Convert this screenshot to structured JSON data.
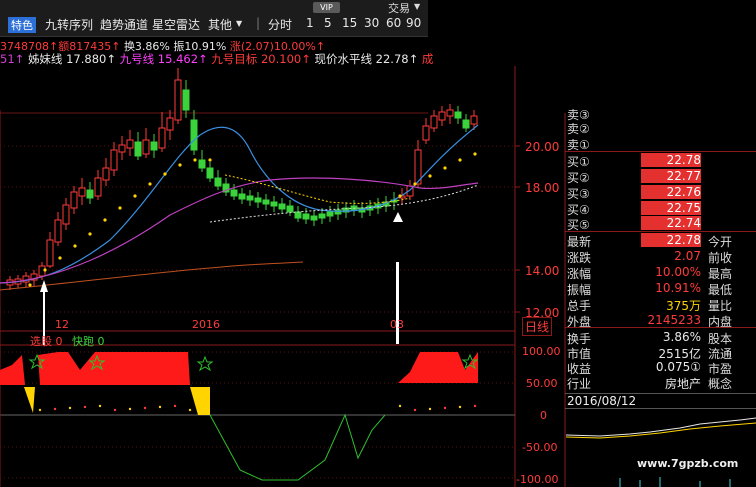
{
  "toolbar": {
    "special_label": "特色",
    "items": [
      "九转序列",
      "趋势通道",
      "星空雷达",
      "其他"
    ],
    "dropdown_caret": "▼",
    "divider": "|",
    "periods": [
      "分时",
      "1",
      "5",
      "15",
      "30",
      "60",
      "90"
    ],
    "vip_label": "VIP",
    "top_right_label": "交易"
  },
  "info_line1": {
    "volume_text": "3748708↑",
    "amount_text": "额817435↑",
    "turnover_text": "换3.86%",
    "amplitude_text": "振10.91%",
    "change_text": "涨(2.07)10.00%↑"
  },
  "info_line2": {
    "prefix": "51↑",
    "sister_line": "姊妹线 17.880↑",
    "nine_line": "九号线 15.462↑",
    "nine_target": "九号目标 20.100↑",
    "price_level": "现价水平线 22.78↑",
    "suffix": "成"
  },
  "price_axis": {
    "labels": [
      "20.00",
      "18.00",
      "14.00",
      "12.00"
    ]
  },
  "date_axis": {
    "labels": [
      "12",
      "2016",
      "03"
    ],
    "period_label": "日线"
  },
  "indicator": {
    "legend_1": "选股",
    "legend_1_val": "0",
    "legend_2": "快跑",
    "legend_2_val": "0",
    "axis_labels": [
      "100.00",
      "50.00",
      "0",
      "-50.00",
      "-100.00"
    ]
  },
  "quote_panel": {
    "sells": [
      {
        "label": "卖③"
      },
      {
        "label": "卖②"
      },
      {
        "label": "卖①"
      }
    ],
    "buys": [
      {
        "label": "买①",
        "price": "22.78"
      },
      {
        "label": "买②",
        "price": "22.77"
      },
      {
        "label": "买③",
        "price": "22.76"
      },
      {
        "label": "买④",
        "price": "22.75"
      },
      {
        "label": "买⑤",
        "price": "22.74"
      }
    ],
    "stats": [
      {
        "label": "最新",
        "value": "22.78",
        "rlabel": "今开"
      },
      {
        "label": "涨跌",
        "value": "2.07",
        "rlabel": "前收"
      },
      {
        "label": "涨幅",
        "value": "10.00%",
        "rlabel": "最高"
      },
      {
        "label": "振幅",
        "value": "10.91%",
        "rlabel": "最低"
      },
      {
        "label": "总手",
        "value": "375万",
        "rlabel": "量比"
      },
      {
        "label": "外盘",
        "value": "2145233",
        "rlabel": "内盘"
      },
      {
        "label": "换手",
        "value": "3.86%",
        "rlabel": "股本"
      },
      {
        "label": "市值",
        "value": "2515亿",
        "rlabel": "流通"
      },
      {
        "label": "收益",
        "value": "0.075①",
        "rlabel": "市盈"
      },
      {
        "label": "行业",
        "value": "房地产",
        "rlabel": "概念"
      }
    ]
  },
  "mini_chart": {
    "date": "2016/08/12"
  },
  "watermark": "www.7gpzb.com",
  "colors": {
    "up": "#ff3b3b",
    "down": "#3bd33b",
    "ma_blue": "#3a8fe0",
    "ma_purple": "#c040c0",
    "accent": "#2c6fd6"
  }
}
